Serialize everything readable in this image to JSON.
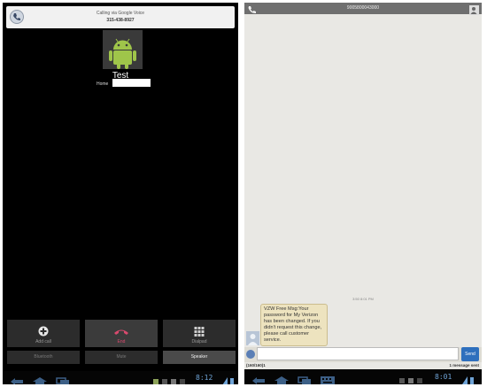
{
  "left": {
    "banner": {
      "line1": "Calling via Google Voice",
      "line2": "315-438-8927"
    },
    "contact": {
      "name": "Test",
      "phone_type": "Home"
    },
    "buttons": {
      "add_call": "Add call",
      "end": "End",
      "dialpad": "Dialpad"
    },
    "toggles": {
      "bluetooth": "Bluetooth",
      "mute": "Mute",
      "speaker": "Speaker"
    },
    "status": {
      "time": "8:12"
    }
  },
  "right": {
    "title": "9005800043000",
    "message": {
      "timestamp": "3:50 8:01 PM",
      "text": "VZW Free Msg:Your password for My Verizon has been changed. If you didn't request this change, please call customer service."
    },
    "compose": {
      "placeholder": "",
      "send_label": "Send",
      "char_count": "(160/160)1",
      "message_count": "1 message sent"
    },
    "status": {
      "time": "8:01"
    }
  },
  "colors": {
    "accent_blue": "#6fa3d6",
    "end_call": "#d94a6e",
    "bubble": "#ede3bf",
    "android_green": "#9fc54a"
  }
}
